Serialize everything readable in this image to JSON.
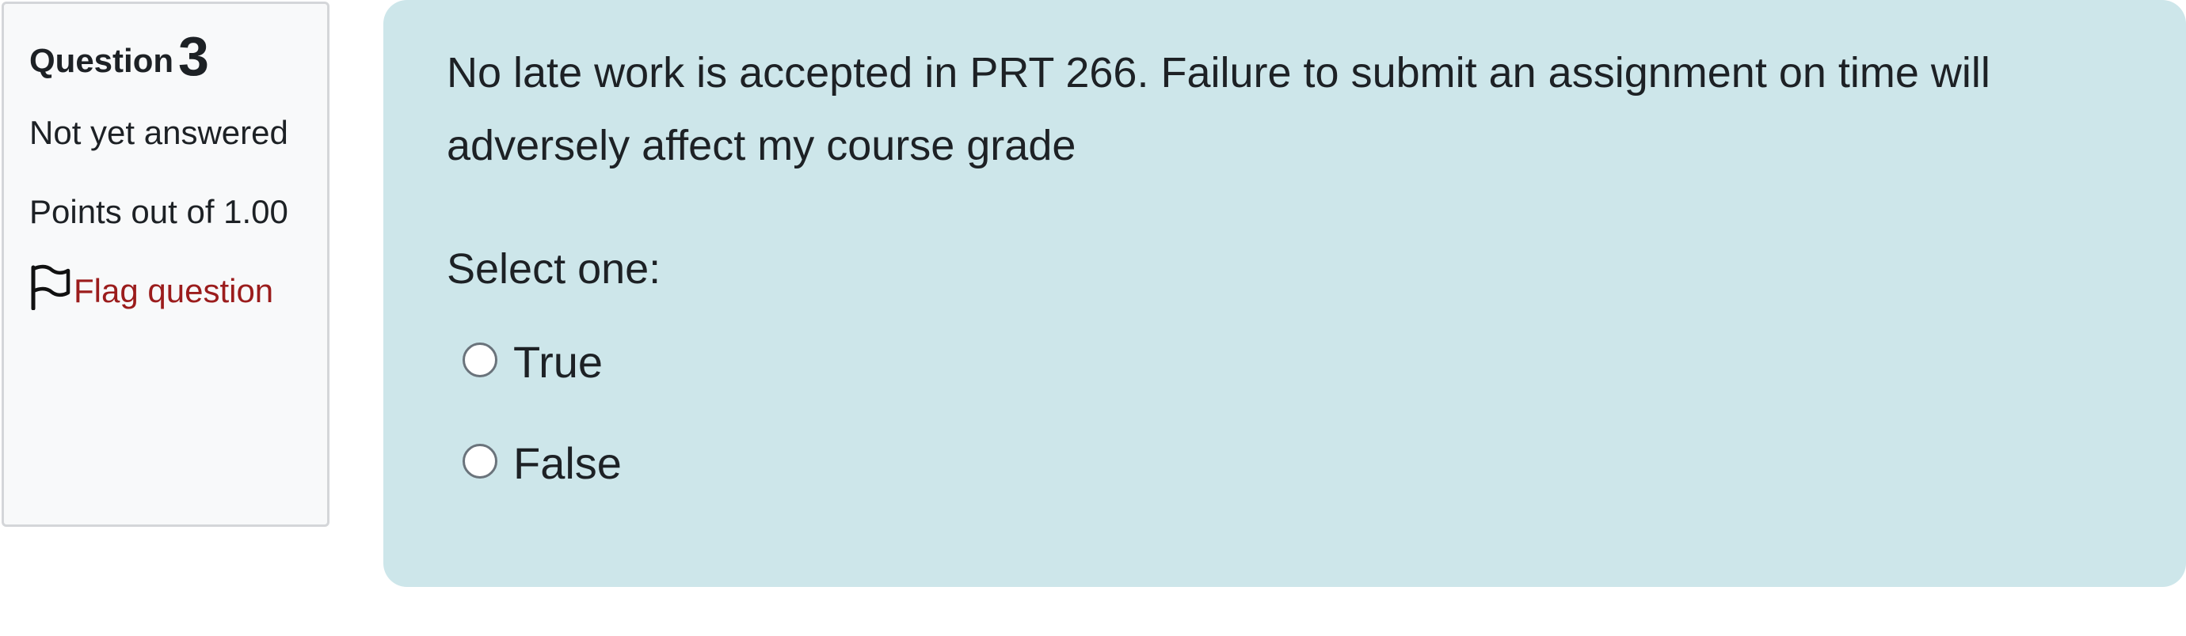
{
  "info": {
    "question_label": "Question",
    "question_number": "3",
    "state": "Not yet answered",
    "grade": "Points out of 1.00",
    "flag_label": "Flag question",
    "flag_icon": "flag-outline-icon"
  },
  "content": {
    "question_text": "No late work is accepted in PRT 266. Failure to submit an assignment on time will adversely affect my course grade",
    "prompt": "Select one:",
    "options": [
      {
        "label": "True",
        "selected": false
      },
      {
        "label": "False",
        "selected": false
      }
    ]
  },
  "colors": {
    "content_background": "#cde6ea",
    "info_background": "#f8f9fa",
    "flag_link": "#9b1c1c"
  }
}
